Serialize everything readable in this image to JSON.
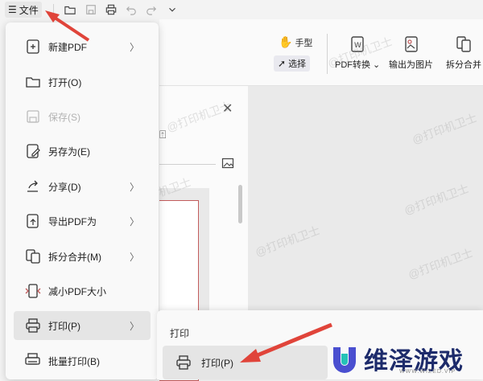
{
  "titlebar": {
    "file_label": "文件"
  },
  "ribbon": {
    "hand_label": "手型",
    "select_label": "选择",
    "pdf_convert": "PDF转换",
    "export_image": "输出为图片",
    "split_merge": "拆分合并"
  },
  "menu": {
    "items": [
      {
        "label": "新建PDF"
      },
      {
        "label": "打开(O)"
      },
      {
        "label": "保存(S)"
      },
      {
        "label": "另存为(E)"
      },
      {
        "label": "分享(D)"
      },
      {
        "label": "导出PDF为"
      },
      {
        "label": "拆分合并(M)"
      },
      {
        "label": "减小PDF大小"
      },
      {
        "label": "打印(P)"
      },
      {
        "label": "批量打印(B)"
      }
    ]
  },
  "submenu": {
    "title": "打印",
    "item_label": "打印(P)"
  },
  "watermark": {
    "text": "@打印机卫士"
  },
  "brand": {
    "name": "维泽游戏",
    "sub": "WWW.WIZED.VIP"
  }
}
